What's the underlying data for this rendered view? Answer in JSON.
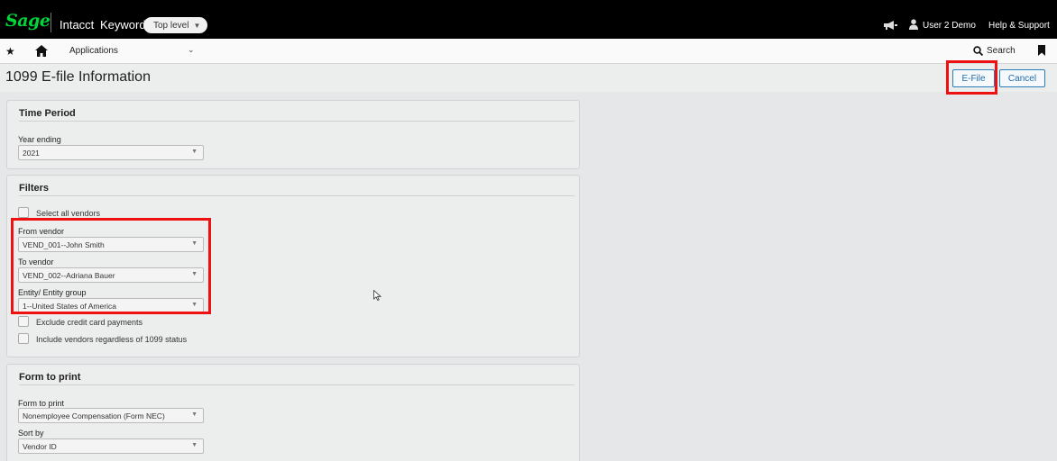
{
  "topbar": {
    "logo": "Sage",
    "product": "Intacct",
    "keyword": "Keyword",
    "level_button": "Top level",
    "user": "User 2 Demo",
    "help": "Help & Support"
  },
  "navbar": {
    "applications": "Applications",
    "search": "Search"
  },
  "page": {
    "title": "1099 E-file Information",
    "efile_button": "E-File",
    "cancel_button": "Cancel"
  },
  "time_period": {
    "title": "Time Period",
    "year_label": "Year ending",
    "year_value": "2021"
  },
  "filters": {
    "title": "Filters",
    "select_all": "Select all vendors",
    "from_vendor_label": "From vendor",
    "from_vendor_value": "VEND_001--John Smith",
    "to_vendor_label": "To vendor",
    "to_vendor_value": "VEND_002--Adriana Bauer",
    "entity_label": "Entity/ Entity group",
    "entity_value": "1--United States of America",
    "exclude_cc": "Exclude credit card payments",
    "include_vendors": "Include vendors regardless of 1099 status"
  },
  "form_to_print": {
    "title": "Form to print",
    "form_label": "Form to print",
    "form_value": "Nonemployee Compensation (Form NEC)",
    "sort_label": "Sort by",
    "sort_value": "Vendor ID"
  },
  "icons": {
    "announce": "megaphone-icon",
    "user": "user-icon",
    "star": "star-icon",
    "home": "home-icon",
    "search": "search-icon",
    "bookmark": "bookmark-icon",
    "chevron": "chevron-down-icon"
  },
  "colors": {
    "brand_green": "#00d639",
    "accent_blue": "#2a7bb8",
    "highlight_red": "#ee1111"
  }
}
